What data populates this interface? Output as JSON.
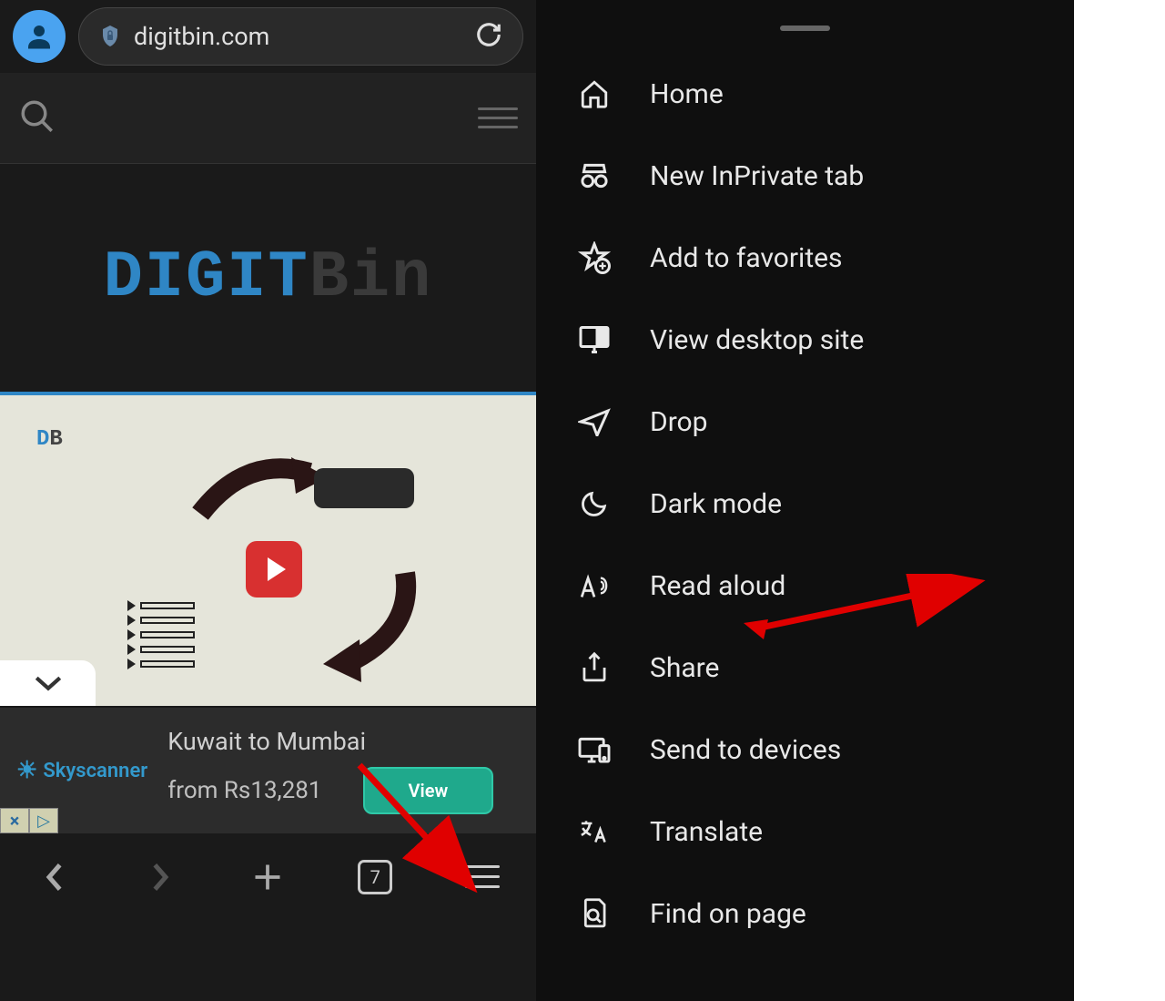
{
  "browser": {
    "url": "digitbin.com",
    "tab_count": "7"
  },
  "logo": {
    "part1": "DIGIT",
    "part2": "Bin"
  },
  "db_badge": {
    "d": "D",
    "b": "B"
  },
  "ad": {
    "brand": "Skyscanner",
    "title": "Kuwait to Mumbai",
    "price": "from Rs13,281",
    "button": "View"
  },
  "ad_badges": {
    "close": "×",
    "tri": "▷"
  },
  "menu": {
    "items": [
      {
        "label": "Home",
        "icon": "home"
      },
      {
        "label": "New InPrivate tab",
        "icon": "inprivate"
      },
      {
        "label": "Add to favorites",
        "icon": "star"
      },
      {
        "label": "View desktop site",
        "icon": "desktop"
      },
      {
        "label": "Drop",
        "icon": "send"
      },
      {
        "label": "Dark mode",
        "icon": "moon"
      },
      {
        "label": "Read aloud",
        "icon": "readaloud"
      },
      {
        "label": "Share",
        "icon": "share"
      },
      {
        "label": "Send to devices",
        "icon": "devices"
      },
      {
        "label": "Translate",
        "icon": "translate"
      },
      {
        "label": "Find on page",
        "icon": "find"
      }
    ]
  }
}
